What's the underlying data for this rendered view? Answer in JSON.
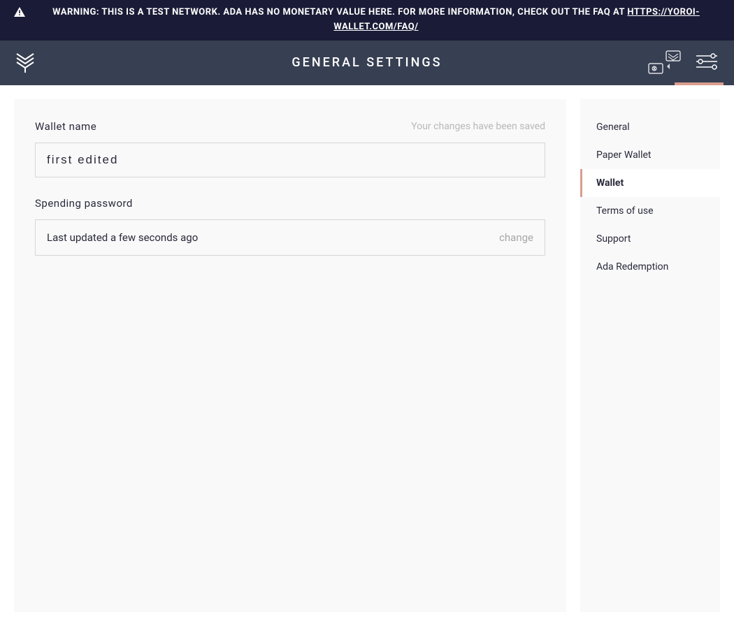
{
  "warning": {
    "text": "WARNING: THIS IS A TEST NETWORK. ADA HAS NO MONETARY VALUE HERE. FOR MORE INFORMATION, CHECK OUT THE FAQ AT ",
    "link_text": "HTTPS://YOROI-WALLET.COM/FAQ/"
  },
  "header": {
    "title": "GENERAL SETTINGS"
  },
  "main": {
    "wallet_name_label": "Wallet name",
    "save_status": "Your changes have been saved",
    "wallet_name_value": "first edited",
    "spending_password_label": "Spending password",
    "password_status": "Last updated a few seconds ago",
    "change_label": "change"
  },
  "sidebar": {
    "items": [
      {
        "label": "General",
        "active": false
      },
      {
        "label": "Paper Wallet",
        "active": false
      },
      {
        "label": "Wallet",
        "active": true
      },
      {
        "label": "Terms of use",
        "active": false
      },
      {
        "label": "Support",
        "active": false
      },
      {
        "label": "Ada Redemption",
        "active": false
      }
    ]
  }
}
